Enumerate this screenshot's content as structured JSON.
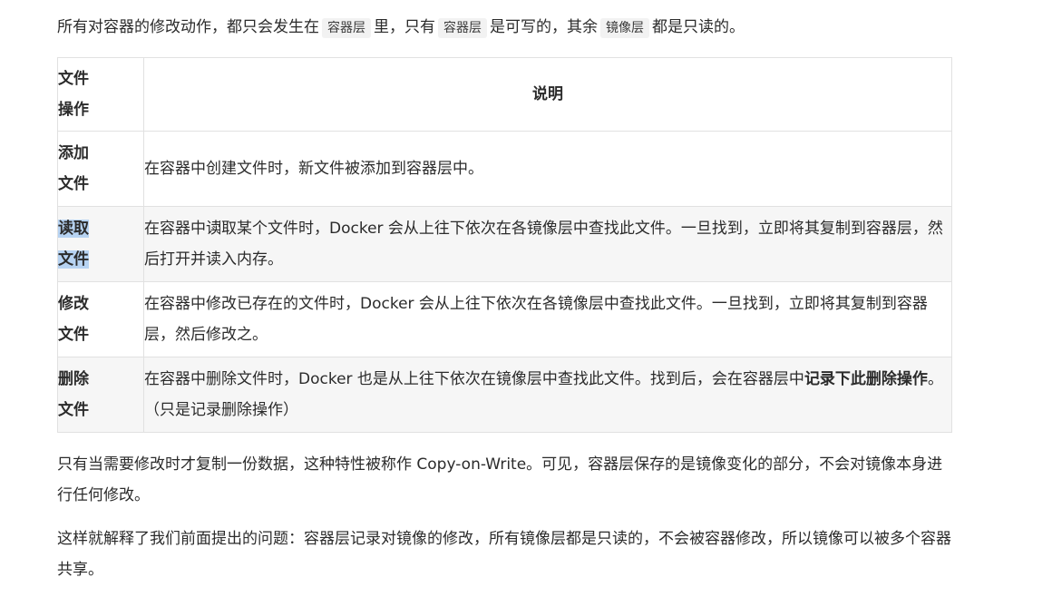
{
  "intro": {
    "t1": "所有对容器的修改动作，都只会发生在",
    "code1": "容器层",
    "t2": "里，只有",
    "code2": "容器层",
    "t3": "是可写的，其余",
    "code3": "镜像层",
    "t4": "都是只读的。"
  },
  "table": {
    "headers": {
      "op": [
        "文件",
        "操作"
      ],
      "desc": "说明"
    },
    "rows": [
      {
        "op": [
          "添加",
          "文件"
        ],
        "desc": "在容器中创建文件时，新文件被添加到容器层中。"
      },
      {
        "op": [
          "读取",
          "文件"
        ],
        "desc_a": "在容器中读",
        "desc_b": "取某个文件时，Docker 会从上往下依次在各镜像层中查找此文件。一旦找到，立即将其复制到容器层，然后打开并读入内存。"
      },
      {
        "op": [
          "修改",
          "文件"
        ],
        "desc": "在容器中修改已存在的文件时，Docker 会从上往下依次在各镜像层中查找此文件。一旦找到，立即将其复制到容器层，然后修改之。"
      },
      {
        "op": [
          "删除",
          "文件"
        ],
        "desc_a": "在容器中删除文件时，Docker 也是从上往下依次在镜像层中查找此文件。找到后，会在容器层中",
        "desc_bold": "记录下此删除操作",
        "desc_b": "。（只是记录删除操作）"
      }
    ]
  },
  "cow": "只有当需要修改时才复制一份数据，这种特性被称作 Copy-on-Write。可见，容器层保存的是镜像变化的部分，不会对镜像本身进行任何修改。",
  "explain": "这样就解释了我们前面提出的问题：容器层记录对镜像的修改，所有镜像层都是只读的，不会被容器修改，所以镜像可以被多个容器共享。"
}
